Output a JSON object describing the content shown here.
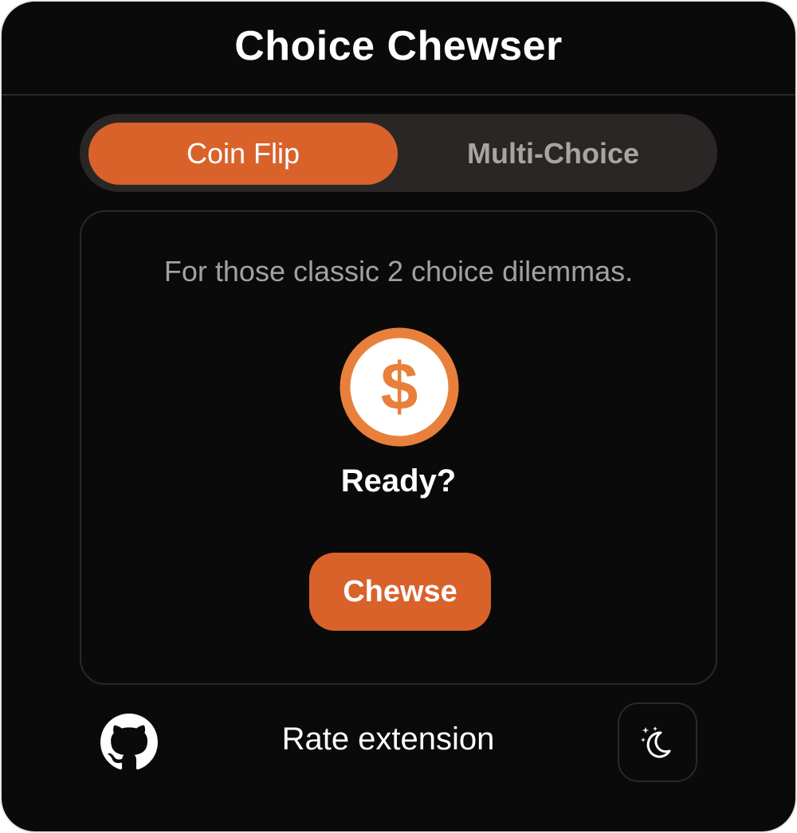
{
  "app": {
    "title": "Choice Chewser"
  },
  "tabs": [
    {
      "label": "Coin Flip",
      "active": true
    },
    {
      "label": "Multi-Choice",
      "active": false
    }
  ],
  "coin_flip": {
    "subtitle": "For those classic 2 choice dilemmas.",
    "coin_icon": "dollar-coin-icon",
    "status": "Ready?",
    "button_label": "Chewse"
  },
  "footer": {
    "github_icon": "github-icon",
    "rate_label": "Rate extension",
    "theme_icon": "moon-stars-icon"
  },
  "colors": {
    "accent": "#d9622b",
    "background": "#0b0a0a",
    "tab_track": "#2a2625",
    "border": "#2b2827",
    "muted_text": "#a5a09e"
  }
}
